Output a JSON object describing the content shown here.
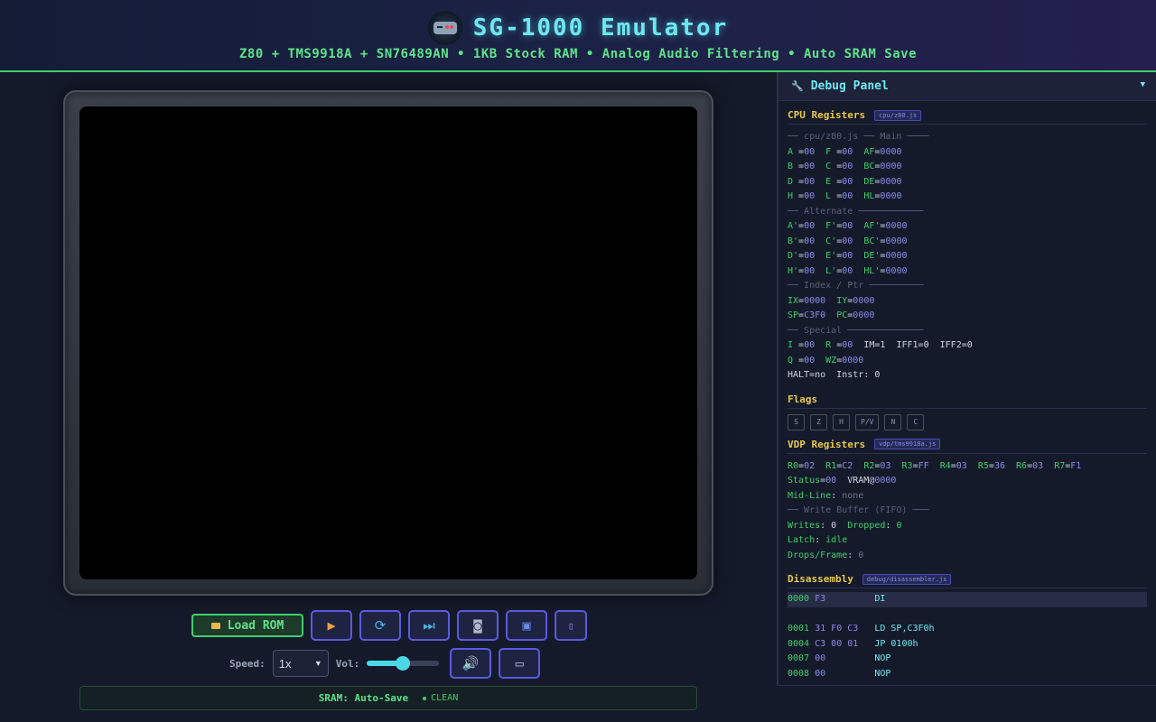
{
  "header": {
    "title": "SG-1000 Emulator",
    "subtitle": "Z80 + TMS9918A + SN76489AN • 1KB Stock RAM • Analog Audio Filtering • Auto SRAM Save"
  },
  "controls": {
    "load_rom": "Load ROM",
    "speed_label": "Speed:",
    "speed_value": "1x",
    "vol_label": "Vol:",
    "volume_level": 0.5
  },
  "sram": {
    "label": "SRAM: Auto-Save",
    "status": "CLEAN"
  },
  "debug": {
    "title": "Debug Panel",
    "cpu": {
      "title": "CPU Registers",
      "badge": "cpu/z80.js",
      "group_main": "── cpu/z80.js ── Main ────",
      "group_alt": "── Alternate ────────────",
      "group_index": "── Index / Ptr ──────────",
      "group_special": "── Special ──────────────",
      "rows_main": [
        [
          [
            "A ",
            "00"
          ],
          [
            "F ",
            "00"
          ],
          [
            "AF",
            "0000"
          ]
        ],
        [
          [
            "B ",
            "00"
          ],
          [
            "C ",
            "00"
          ],
          [
            "BC",
            "0000"
          ]
        ],
        [
          [
            "D ",
            "00"
          ],
          [
            "E ",
            "00"
          ],
          [
            "DE",
            "0000"
          ]
        ],
        [
          [
            "H ",
            "00"
          ],
          [
            "L ",
            "00"
          ],
          [
            "HL",
            "0000"
          ]
        ]
      ],
      "rows_alt": [
        [
          [
            "A'",
            "00"
          ],
          [
            "F'",
            "00"
          ],
          [
            "AF'",
            "0000"
          ]
        ],
        [
          [
            "B'",
            "00"
          ],
          [
            "C'",
            "00"
          ],
          [
            "BC'",
            "0000"
          ]
        ],
        [
          [
            "D'",
            "00"
          ],
          [
            "E'",
            "00"
          ],
          [
            "DE'",
            "0000"
          ]
        ],
        [
          [
            "H'",
            "00"
          ],
          [
            "L'",
            "00"
          ],
          [
            "HL'",
            "0000"
          ]
        ]
      ],
      "IX": "0000",
      "IY": "0000",
      "SP": "C3F0",
      "PC": "0000",
      "I": "00",
      "R": "00",
      "im_line": "IM=1  IFF1=0  IFF2=0",
      "Q": "00",
      "WZ": "0000",
      "halt_line": "HALT=no  Instr: 0"
    },
    "flags": {
      "title": "Flags",
      "items": [
        "S",
        "Z",
        "H",
        "P/V",
        "N",
        "C"
      ]
    },
    "vdp": {
      "title": "VDP Registers",
      "badge": "vdp/tms9918a.js",
      "regs": [
        [
          "R0",
          "02"
        ],
        [
          "R1",
          "C2"
        ],
        [
          "R2",
          "03"
        ],
        [
          "R3",
          "FF"
        ],
        [
          "R4",
          "03"
        ],
        [
          "R5",
          "36"
        ],
        [
          "R6",
          "03"
        ],
        [
          "R7",
          "F1"
        ]
      ],
      "status": "00",
      "vram_label": "VRAM@",
      "vram": "0000",
      "midline_label": "Mid-Line",
      "midline": "none",
      "group_fifo": "── Write Buffer (FIFO) ───",
      "writes_label": "Writes",
      "writes": "0",
      "dropped_label": "Dropped",
      "dropped": "0",
      "latch_label": "Latch",
      "latch": "idle",
      "drops_label": "Drops/Frame",
      "drops": "0"
    },
    "disasm": {
      "title": "Disassembly",
      "badge": "debug/disassembler.js",
      "rows": [
        {
          "addr": "0000",
          "bytes": "F3",
          "instr": "DI"
        },
        {
          "addr": "",
          "bytes": "",
          "instr": ""
        },
        {
          "addr": "0001",
          "bytes": "31 F0 C3",
          "instr": "LD SP,C3F0h"
        },
        {
          "addr": "0004",
          "bytes": "C3 00 01",
          "instr": "JP 0100h"
        },
        {
          "addr": "0007",
          "bytes": "00",
          "instr": "NOP"
        },
        {
          "addr": "0008",
          "bytes": "00",
          "instr": "NOP"
        }
      ]
    }
  },
  "colors": {
    "accent_cyan": "#6fe8f0",
    "accent_green": "#3fcf6a",
    "accent_purple": "#5a5ae0",
    "section_yellow": "#e8c84a"
  },
  "icons": [
    "gamepad-icon",
    "folder-icon",
    "play-icon",
    "reset-icon",
    "fast-forward-icon",
    "camera-icon",
    "save-icon",
    "info-icon",
    "speaker-icon",
    "tv-icon",
    "wrench-icon",
    "chevron-down-icon"
  ]
}
